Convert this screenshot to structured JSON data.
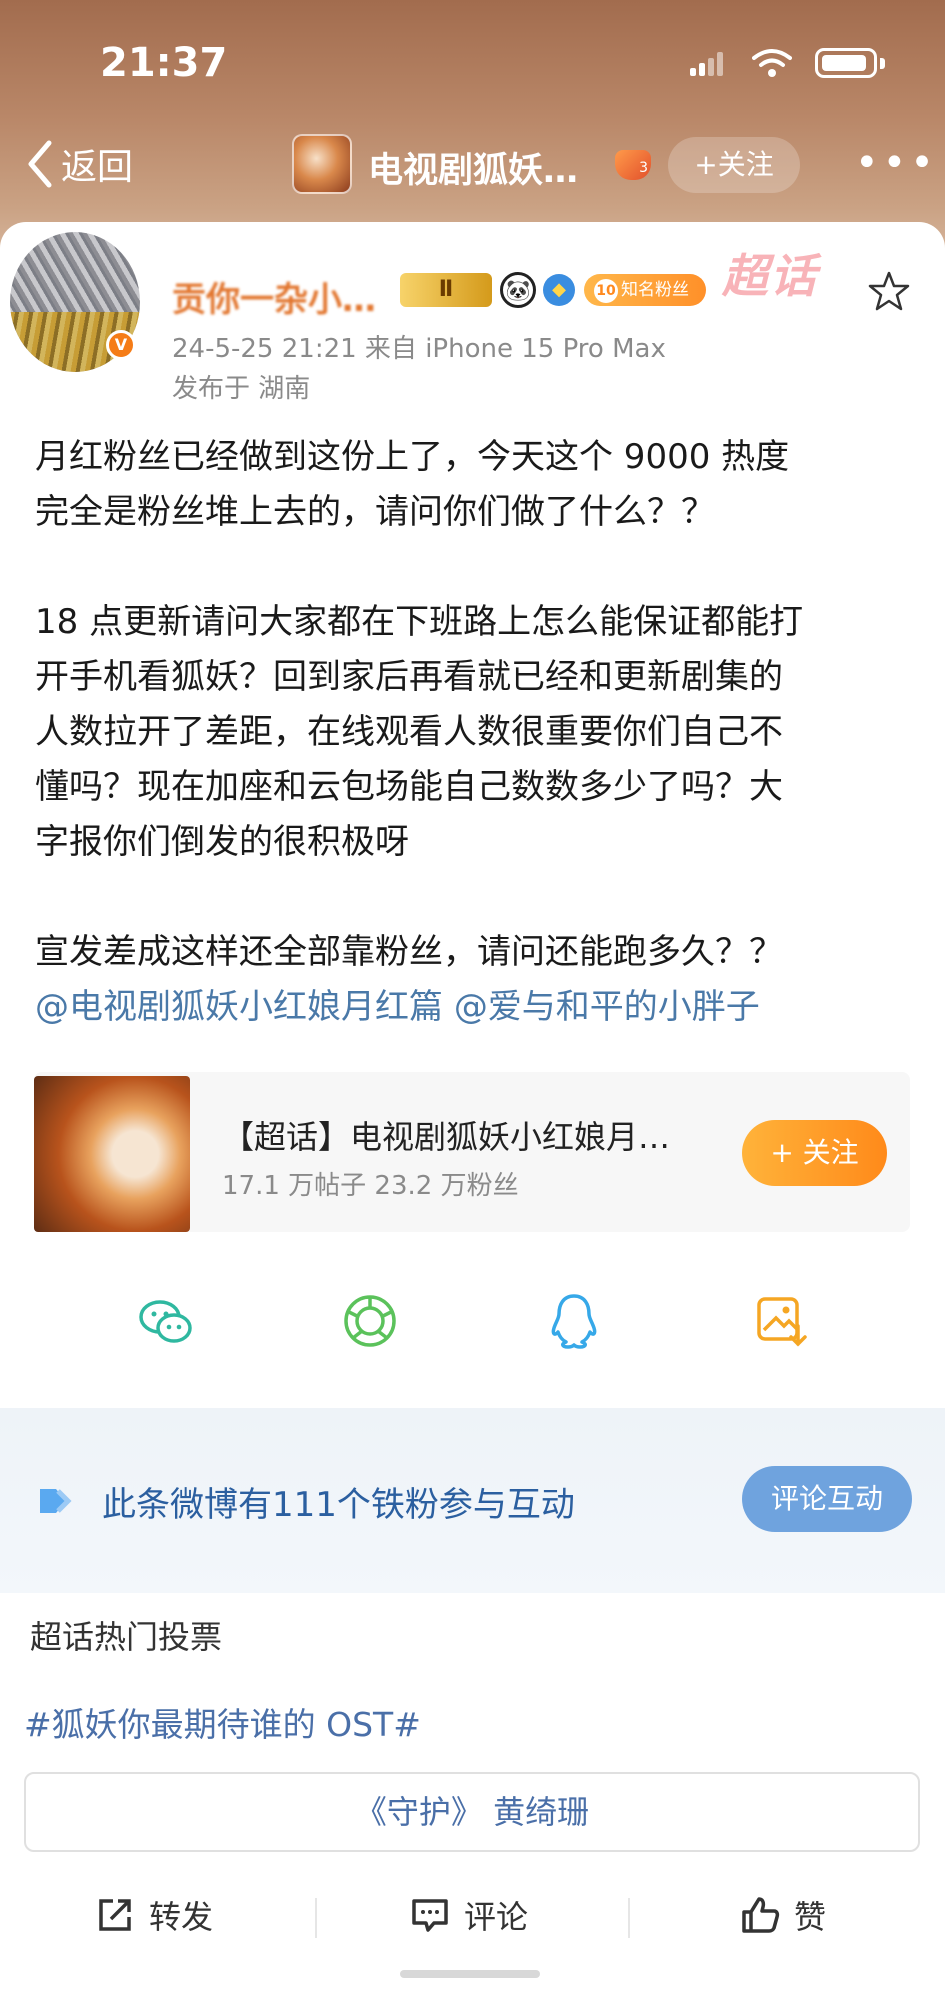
{
  "status_bar": {
    "time": "21:37"
  },
  "nav": {
    "back_label": "返回",
    "title": "电视剧狐妖…",
    "level_badge": "3",
    "follow_label": "+关注"
  },
  "post": {
    "username": "贡你一杂小…",
    "crown_badge": "Ⅱ",
    "fan_badge_level": "10",
    "fan_badge_label": "知名粉丝",
    "watermark": "超话",
    "meta": "24-5-25 21:21  来自 iPhone 15 Pro Max",
    "location": "发布于 湖南",
    "paragraph1": [
      "月红粉丝已经做到这份上了，今天这个 9000 热度",
      "完全是粉丝堆上去的，请问你们做了什么？？"
    ],
    "paragraph2": [
      "18 点更新请问大家都在下班路上怎么能保证都能打",
      "开手机看狐妖？回到家后再看就已经和更新剧集的",
      "人数拉开了差距，在线观看人数很重要你们自己不",
      "懂吗？现在加座和云包场能自己数数多少了吗？大",
      "字报你们倒发的很积极呀"
    ],
    "paragraph3": "宣发差成这样还全部靠粉丝，请问还能跑多久？？",
    "mention1": "@电视剧狐妖小红娘月红篇",
    "mention2": "@爱与和平的小胖子"
  },
  "chaohua_card": {
    "title": "【超话】电视剧狐妖小红娘月…",
    "stats": "17.1 万帖子  23.2 万粉丝",
    "follow_label": "+ 关注"
  },
  "share": {
    "icons": [
      "wechat-icon",
      "moments-icon",
      "qq-icon",
      "save-image-icon"
    ]
  },
  "fans_banner": {
    "text": "此条微博有111个铁粉参与互动",
    "button_label": "评论互动"
  },
  "vote": {
    "title": "超话热门投票",
    "topic": "#狐妖你最期待谁的 OST#",
    "option": "《守护》 黄绮珊"
  },
  "actions": {
    "repost": "转发",
    "comment": "评论",
    "like": "赞"
  },
  "colors": {
    "header_brown": "#a26c4e",
    "link_blue": "#4a79a8",
    "accent_orange": "#ff8a1a",
    "fans_blue": "#2b5fa0"
  }
}
